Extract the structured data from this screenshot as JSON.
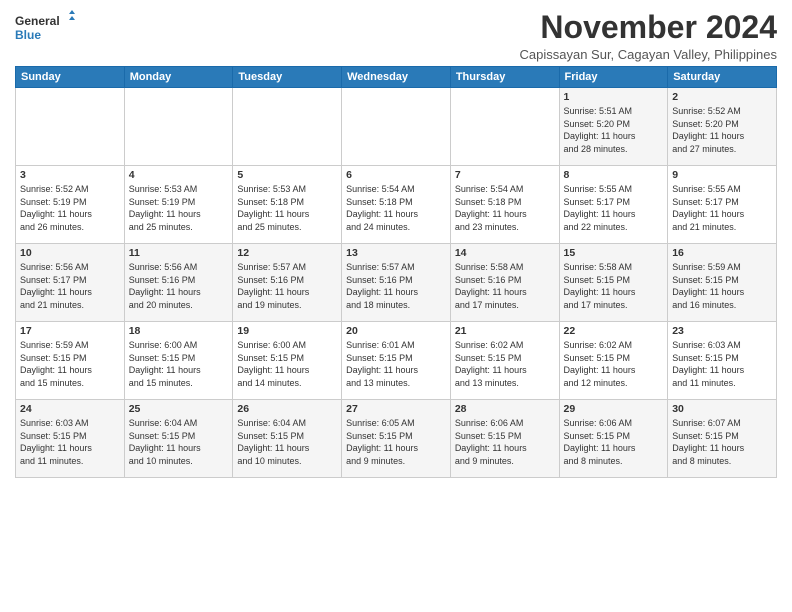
{
  "logo": {
    "general": "General",
    "blue": "Blue"
  },
  "title": "November 2024",
  "subtitle": "Capissayan Sur, Cagayan Valley, Philippines",
  "days_of_week": [
    "Sunday",
    "Monday",
    "Tuesday",
    "Wednesday",
    "Thursday",
    "Friday",
    "Saturday"
  ],
  "weeks": [
    [
      {
        "day": "",
        "info": ""
      },
      {
        "day": "",
        "info": ""
      },
      {
        "day": "",
        "info": ""
      },
      {
        "day": "",
        "info": ""
      },
      {
        "day": "",
        "info": ""
      },
      {
        "day": "1",
        "info": "Sunrise: 5:51 AM\nSunset: 5:20 PM\nDaylight: 11 hours\nand 28 minutes."
      },
      {
        "day": "2",
        "info": "Sunrise: 5:52 AM\nSunset: 5:20 PM\nDaylight: 11 hours\nand 27 minutes."
      }
    ],
    [
      {
        "day": "3",
        "info": "Sunrise: 5:52 AM\nSunset: 5:19 PM\nDaylight: 11 hours\nand 26 minutes."
      },
      {
        "day": "4",
        "info": "Sunrise: 5:53 AM\nSunset: 5:19 PM\nDaylight: 11 hours\nand 25 minutes."
      },
      {
        "day": "5",
        "info": "Sunrise: 5:53 AM\nSunset: 5:18 PM\nDaylight: 11 hours\nand 25 minutes."
      },
      {
        "day": "6",
        "info": "Sunrise: 5:54 AM\nSunset: 5:18 PM\nDaylight: 11 hours\nand 24 minutes."
      },
      {
        "day": "7",
        "info": "Sunrise: 5:54 AM\nSunset: 5:18 PM\nDaylight: 11 hours\nand 23 minutes."
      },
      {
        "day": "8",
        "info": "Sunrise: 5:55 AM\nSunset: 5:17 PM\nDaylight: 11 hours\nand 22 minutes."
      },
      {
        "day": "9",
        "info": "Sunrise: 5:55 AM\nSunset: 5:17 PM\nDaylight: 11 hours\nand 21 minutes."
      }
    ],
    [
      {
        "day": "10",
        "info": "Sunrise: 5:56 AM\nSunset: 5:17 PM\nDaylight: 11 hours\nand 21 minutes."
      },
      {
        "day": "11",
        "info": "Sunrise: 5:56 AM\nSunset: 5:16 PM\nDaylight: 11 hours\nand 20 minutes."
      },
      {
        "day": "12",
        "info": "Sunrise: 5:57 AM\nSunset: 5:16 PM\nDaylight: 11 hours\nand 19 minutes."
      },
      {
        "day": "13",
        "info": "Sunrise: 5:57 AM\nSunset: 5:16 PM\nDaylight: 11 hours\nand 18 minutes."
      },
      {
        "day": "14",
        "info": "Sunrise: 5:58 AM\nSunset: 5:16 PM\nDaylight: 11 hours\nand 17 minutes."
      },
      {
        "day": "15",
        "info": "Sunrise: 5:58 AM\nSunset: 5:15 PM\nDaylight: 11 hours\nand 17 minutes."
      },
      {
        "day": "16",
        "info": "Sunrise: 5:59 AM\nSunset: 5:15 PM\nDaylight: 11 hours\nand 16 minutes."
      }
    ],
    [
      {
        "day": "17",
        "info": "Sunrise: 5:59 AM\nSunset: 5:15 PM\nDaylight: 11 hours\nand 15 minutes."
      },
      {
        "day": "18",
        "info": "Sunrise: 6:00 AM\nSunset: 5:15 PM\nDaylight: 11 hours\nand 15 minutes."
      },
      {
        "day": "19",
        "info": "Sunrise: 6:00 AM\nSunset: 5:15 PM\nDaylight: 11 hours\nand 14 minutes."
      },
      {
        "day": "20",
        "info": "Sunrise: 6:01 AM\nSunset: 5:15 PM\nDaylight: 11 hours\nand 13 minutes."
      },
      {
        "day": "21",
        "info": "Sunrise: 6:02 AM\nSunset: 5:15 PM\nDaylight: 11 hours\nand 13 minutes."
      },
      {
        "day": "22",
        "info": "Sunrise: 6:02 AM\nSunset: 5:15 PM\nDaylight: 11 hours\nand 12 minutes."
      },
      {
        "day": "23",
        "info": "Sunrise: 6:03 AM\nSunset: 5:15 PM\nDaylight: 11 hours\nand 11 minutes."
      }
    ],
    [
      {
        "day": "24",
        "info": "Sunrise: 6:03 AM\nSunset: 5:15 PM\nDaylight: 11 hours\nand 11 minutes."
      },
      {
        "day": "25",
        "info": "Sunrise: 6:04 AM\nSunset: 5:15 PM\nDaylight: 11 hours\nand 10 minutes."
      },
      {
        "day": "26",
        "info": "Sunrise: 6:04 AM\nSunset: 5:15 PM\nDaylight: 11 hours\nand 10 minutes."
      },
      {
        "day": "27",
        "info": "Sunrise: 6:05 AM\nSunset: 5:15 PM\nDaylight: 11 hours\nand 9 minutes."
      },
      {
        "day": "28",
        "info": "Sunrise: 6:06 AM\nSunset: 5:15 PM\nDaylight: 11 hours\nand 9 minutes."
      },
      {
        "day": "29",
        "info": "Sunrise: 6:06 AM\nSunset: 5:15 PM\nDaylight: 11 hours\nand 8 minutes."
      },
      {
        "day": "30",
        "info": "Sunrise: 6:07 AM\nSunset: 5:15 PM\nDaylight: 11 hours\nand 8 minutes."
      }
    ]
  ],
  "accent_color": "#2a7ab8"
}
